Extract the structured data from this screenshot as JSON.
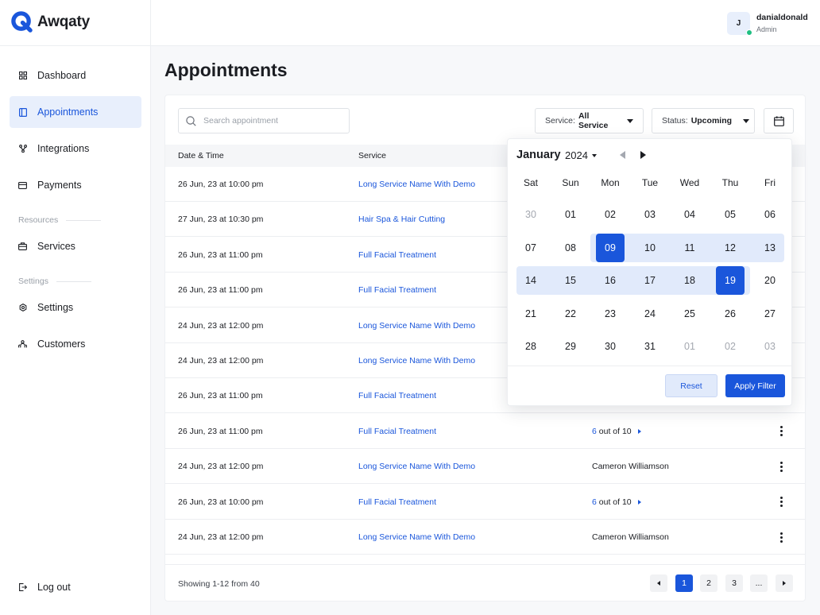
{
  "brand": {
    "name": "Awqaty"
  },
  "sidebar": {
    "items": [
      {
        "label": "Dashboard",
        "icon": "grid-icon"
      },
      {
        "label": "Appointments",
        "icon": "calendar-panel-icon"
      },
      {
        "label": "Integrations",
        "icon": "integrations-icon"
      },
      {
        "label": "Payments",
        "icon": "payments-icon"
      },
      {
        "label": "Services",
        "icon": "briefcase-icon"
      },
      {
        "label": "Settings",
        "icon": "gear-icon"
      },
      {
        "label": "Customers",
        "icon": "users-icon"
      }
    ],
    "sections": {
      "resources": "Resources",
      "settings": "Settings"
    },
    "logout": "Log out"
  },
  "user": {
    "initial": "J",
    "name": "danialdonald",
    "role": "Admin",
    "status_color": "#1fbf82"
  },
  "page": {
    "title": "Appointments"
  },
  "search": {
    "placeholder": "Search appointment"
  },
  "filters": {
    "service": {
      "label": "Service:",
      "value": "All Service"
    },
    "status": {
      "label": "Status:",
      "value": "Upcoming"
    }
  },
  "table": {
    "headers": {
      "date": "Date & Time",
      "service": "Service"
    },
    "rows": [
      {
        "date": "26 Jun, 23 at 10:00 pm",
        "service": "Long Service Name With Demo"
      },
      {
        "date": "27 Jun, 23 at 10:30 pm",
        "service": "Hair Spa & Hair Cutting"
      },
      {
        "date": "26 Jun, 23 at 11:00 pm",
        "service": "Full Facial Treatment"
      },
      {
        "date": "26 Jun, 23 at 11:00 pm",
        "service": "Full Facial Treatment"
      },
      {
        "date": "24 Jun, 23 at 12:00 pm",
        "service": "Long Service Name With Demo"
      },
      {
        "date": "24 Jun, 23 at 12:00 pm",
        "service": "Long Service Name With Demo"
      },
      {
        "date": "26 Jun, 23 at 11:00 pm",
        "service": "Full Facial Treatment"
      },
      {
        "date": "26 Jun, 23 at 11:00 pm",
        "service": "Full Facial Treatment",
        "cust_num": "6",
        "cust_rest": " out of 10"
      },
      {
        "date": "24 Jun, 23 at 12:00 pm",
        "service": "Long Service Name With Demo",
        "customer": "Cameron Williamson"
      },
      {
        "date": "26 Jun, 23 at 10:00 pm",
        "service": "Full Facial Treatment",
        "cust_num": "6",
        "cust_rest": " out of 10"
      },
      {
        "date": "24 Jun, 23 at 12:00 pm",
        "service": "Long Service Name With Demo",
        "customer": "Cameron Williamson"
      }
    ]
  },
  "pagination": {
    "summary": "Showing 1-12 from 40",
    "pages": [
      "1",
      "2",
      "3",
      "..."
    ],
    "active_page": "1"
  },
  "calendar": {
    "month": "January",
    "year": "2024",
    "weekdays": [
      "Sat",
      "Sun",
      "Mon",
      "Tue",
      "Wed",
      "Thu",
      "Fri"
    ],
    "weeks": [
      [
        "30",
        "01",
        "02",
        "03",
        "04",
        "05",
        "06"
      ],
      [
        "07",
        "08",
        "09",
        "10",
        "11",
        "12",
        "13"
      ],
      [
        "14",
        "15",
        "16",
        "17",
        "18",
        "19",
        "20"
      ],
      [
        "21",
        "22",
        "23",
        "24",
        "25",
        "26",
        "27"
      ],
      [
        "28",
        "29",
        "30",
        "31",
        "01",
        "02",
        "03"
      ]
    ],
    "range_start": "09",
    "range_end": "19",
    "reset_label": "Reset",
    "apply_label": "Apply Filter"
  },
  "colors": {
    "accent": "#1a56db",
    "accent_soft": "#e1eafb",
    "success": "#1fbf82"
  }
}
